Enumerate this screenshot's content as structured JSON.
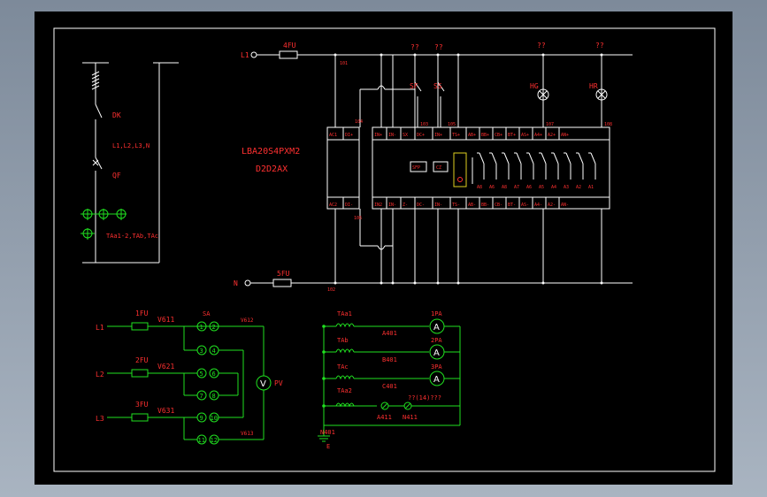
{
  "top": {
    "l1": "L1",
    "n": "N",
    "fu4": "4FU",
    "fu5": "5FU",
    "n101": "101",
    "n102": "102",
    "n103": "103",
    "n104": "104",
    "n105": "105",
    "n106": "106",
    "n107": "107",
    "n108": "108",
    "q1": "??",
    "q2": "??",
    "q3": "??",
    "q4": "??",
    "sf": "SF",
    "ss": "SS",
    "hg": "HG",
    "hr": "HR",
    "model1": "LBA20S4PXM2",
    "model2": "D2D2AX",
    "term_top": [
      "AC1",
      "DI+",
      "IN+",
      "IN-",
      "SX",
      "DC+",
      "IN+",
      "TS+",
      "AB+",
      "BB+",
      "CB+",
      "BT+",
      "AS+",
      "A4+",
      "A2+",
      "AN+"
    ],
    "term_bot": [
      "AC2",
      "DI-",
      "IN2",
      "IN-",
      "Z-",
      "DC-",
      "IN-",
      "TS-",
      "AB-",
      "BB-",
      "CB-",
      "BT-",
      "AS-",
      "A4-",
      "A2-",
      "AN-"
    ],
    "relay_labels": [
      "A8",
      "A6",
      "A8",
      "A7",
      "A6",
      "A5",
      "A4",
      "A3",
      "A2",
      "A1"
    ],
    "box_sfp": "SFP",
    "box_cz": "CZ"
  },
  "left": {
    "dk": "DK",
    "lbus": "L1,L2,L3,N",
    "qf": "QF",
    "ta": "TAa1-2,TAb,TAc"
  },
  "volt": {
    "l1": "L1",
    "l2": "L2",
    "l3": "L3",
    "fu1": "1FU",
    "fu2": "2FU",
    "fu3": "3FU",
    "v611": "V611",
    "v621": "V621",
    "v631": "V631",
    "sa": "SA",
    "v612": "V612",
    "v613": "V613",
    "pv": "PV",
    "contacts": [
      "1",
      "2",
      "3",
      "4",
      "5",
      "6",
      "7",
      "8",
      "9",
      "10",
      "11",
      "12"
    ],
    "meter": "V"
  },
  "curr": {
    "taa1": "TAa1",
    "tab": "TAb",
    "tac": "TAc",
    "taa2": "TAa2",
    "pa1": "1PA",
    "pa2": "2PA",
    "pa3": "3PA",
    "a401": "A401",
    "b401": "B401",
    "c401": "C401",
    "a411": "A411",
    "n411": "N411",
    "n401": "N401",
    "note": "??(14)???",
    "earth": "E",
    "meter": "A"
  }
}
